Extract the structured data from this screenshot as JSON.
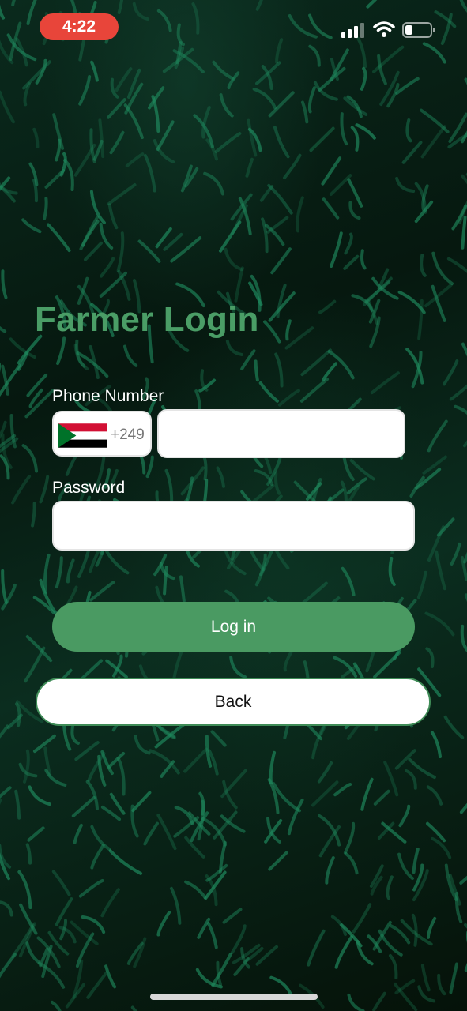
{
  "status_bar": {
    "time": "4:22",
    "signal_icon": "cellular-signal-icon",
    "wifi_icon": "wifi-icon",
    "battery_icon": "battery-icon",
    "battery_level": 0.3
  },
  "title": "Farmer Login",
  "phone": {
    "label": "Phone Number",
    "country_flag_icon": "sudan-flag-icon",
    "dial_code": "+249",
    "value": "",
    "placeholder": ""
  },
  "password": {
    "label": "Password",
    "value": "",
    "placeholder": ""
  },
  "buttons": {
    "login": "Log in",
    "back": "Back"
  },
  "colors": {
    "accent": "#4a9a62",
    "title": "#4a9d66",
    "time_pill": "#e8453a"
  }
}
